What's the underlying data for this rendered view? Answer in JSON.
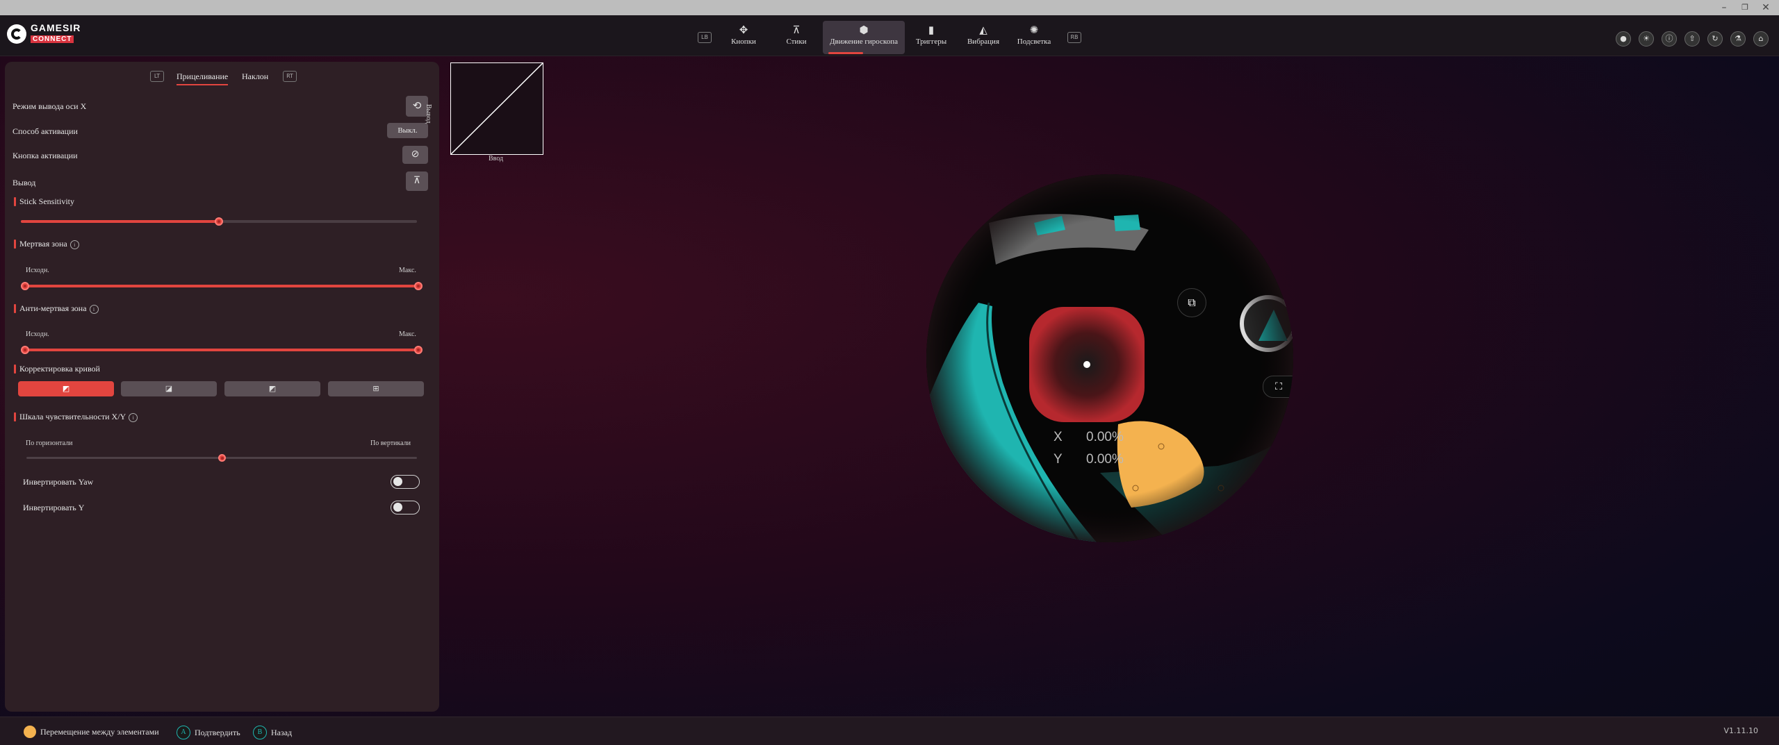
{
  "app": {
    "brand_top": "GAMESIR",
    "brand_bottom": "CONNECT",
    "version": "V1.11.10"
  },
  "nav": {
    "left_badge": "LB",
    "right_badge": "RB",
    "tabs": [
      {
        "label": "Кнопки",
        "icon": "dpad-icon"
      },
      {
        "label": "Стики",
        "icon": "joystick-icon"
      },
      {
        "label": "Движение гироскопа",
        "icon": "gyro-icon",
        "active": true
      },
      {
        "label": "Триггеры",
        "icon": "trigger-icon"
      },
      {
        "label": "Вибрация",
        "icon": "vibration-icon"
      },
      {
        "label": "Подсветка",
        "icon": "light-icon"
      }
    ]
  },
  "panel": {
    "tabs": {
      "left_badge": "LT",
      "right_badge": "RT",
      "aim": "Прицеливание",
      "tilt": "Наклон"
    },
    "x_output_mode": "Режим вывода оси X",
    "activation_mode": "Способ активации",
    "activation_mode_value": "Выкл.",
    "activation_button": "Кнопка активации",
    "output": "Вывод",
    "stick_sensitivity": {
      "title": "Stick Sensitivity",
      "value": 0.5
    },
    "deadzone": {
      "title": "Мертвая зона",
      "min_label": "Исходн.",
      "max_label": "Макс.",
      "low": 0.0,
      "high": 1.0
    },
    "anti_deadzone": {
      "title": "Анти-мертвая зона",
      "min_label": "Исходн.",
      "max_label": "Макс.",
      "low": 0.0,
      "high": 1.0
    },
    "curve": {
      "title": "Корректировка кривой",
      "active_index": 0
    },
    "xy_scale": {
      "title": "Шкала чувствительности X/Y",
      "left_label": "По горизонтали",
      "right_label": "По вертикали",
      "value": 0.5
    },
    "invert_yaw": "Инвертировать Yaw",
    "invert_y": "Инвертировать Y"
  },
  "graph": {
    "x_label": "Ввод",
    "y_label": "Вывод"
  },
  "readout": {
    "x_label": "X",
    "x_value": "0.00%",
    "y_label": "Y",
    "y_value": "0.00%"
  },
  "status": {
    "move_hint": "Перемещение между элементами",
    "confirm_hint": "Подтвердить",
    "back_hint": "Назад"
  },
  "colors": {
    "accent": "#e2453f",
    "teal": "#1fb5b0",
    "yellow": "#f4b24f",
    "panel": "#2e1f25"
  }
}
